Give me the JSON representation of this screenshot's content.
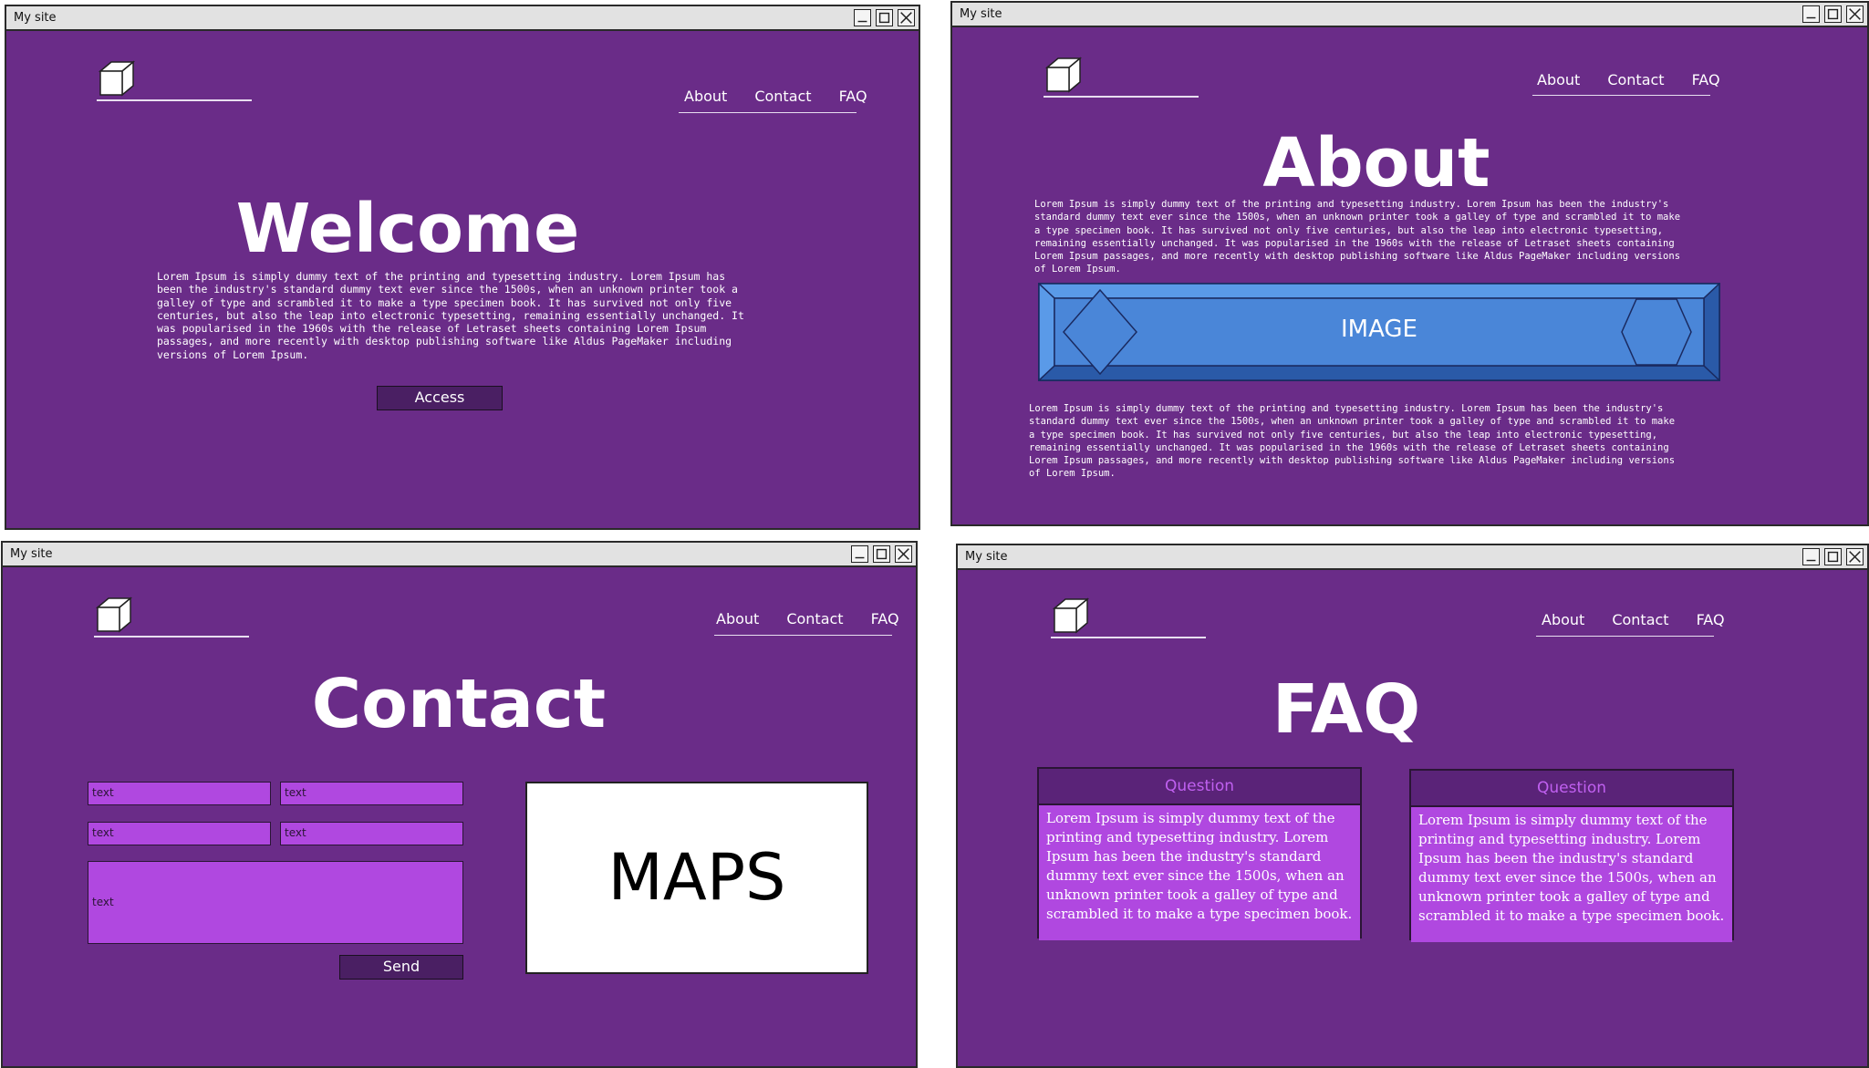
{
  "window_title": "My site",
  "nav": {
    "about": "About",
    "contact": "Contact",
    "faq": "FAQ"
  },
  "home": {
    "title": "Welcome",
    "body": "Lorem Ipsum is simply dummy text of the printing and typesetting industry. Lorem Ipsum has\nbeen the industry's standard dummy text ever since the 1500s, when an unknown printer took a\ngalley of type and scrambled it to make a type specimen book. It has survived not only five\ncenturies, but also the leap into electronic typesetting, remaining essentially unchanged. It\nwas popularised in the 1960s with the release of Letraset sheets containing Lorem Ipsum\npassages, and more recently with desktop publishing software like Aldus PageMaker including\nversions of Lorem Ipsum.",
    "button": "Access"
  },
  "about": {
    "title": "About",
    "body1": "Lorem Ipsum is simply dummy text of the printing and typesetting industry. Lorem Ipsum has been the industry's\nstandard dummy text ever since the 1500s, when an unknown printer took a galley of type and scrambled it to make\na type specimen book. It has survived not only five centuries, but also the leap into electronic typesetting,\nremaining essentially unchanged. It was popularised in the 1960s with the release of Letraset sheets containing\nLorem Ipsum passages, and more recently with desktop publishing software like Aldus PageMaker including versions\nof Lorem Ipsum.",
    "image_label": "IMAGE",
    "body2": "Lorem Ipsum is simply dummy text of the printing and typesetting industry. Lorem Ipsum has been the industry's\nstandard dummy text ever since the 1500s, when an unknown printer took a galley of type and scrambled it to make\na type specimen book. It has survived not only five centuries, but also the leap into electronic typesetting,\nremaining essentially unchanged. It was popularised in the 1960s with the release of Letraset sheets containing\nLorem Ipsum passages, and more recently with desktop publishing software like Aldus PageMaker including versions\nof Lorem Ipsum."
  },
  "contact": {
    "title": "Contact",
    "fields": [
      "text",
      "text",
      "text",
      "text"
    ],
    "message": "text",
    "button": "Send",
    "map_label": "MAPS"
  },
  "faq": {
    "title": "FAQ",
    "items": [
      {
        "question": "Question",
        "answer": "Lorem Ipsum is simply dummy text of the printing and typesetting industry. Lorem Ipsum has been the industry's standard dummy text ever since the 1500s, when an unknown printer took a galley of type and scrambled it to make a type specimen book."
      },
      {
        "question": "Question",
        "answer": "Lorem Ipsum is simply dummy text of the printing and typesetting industry. Lorem Ipsum has been the industry's standard dummy text ever since the 1500s, when an unknown printer took a galley of type and scrambled it to make a type specimen book."
      }
    ]
  },
  "colors": {
    "background": "#6a2c88",
    "field": "#b048e0",
    "dark_button": "#4a1f63",
    "image_blue": "#4a86d8"
  }
}
